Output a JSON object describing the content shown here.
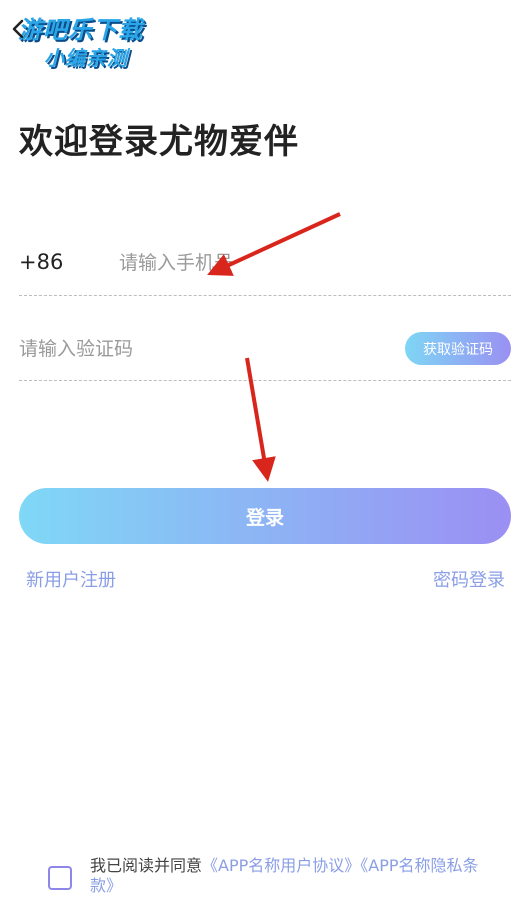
{
  "watermark": {
    "line1": "游吧乐下载",
    "line2": "小编亲测"
  },
  "header": {
    "back_icon": "chevron-left-icon"
  },
  "title": "欢迎登录尤物爱伴",
  "phone": {
    "country_code": "+86",
    "placeholder": "请输入手机号"
  },
  "code": {
    "placeholder": "请输入验证码",
    "get_code_label": "获取验证码"
  },
  "login_label": "登录",
  "links": {
    "register": "新用户注册",
    "password_login": "密码登录"
  },
  "agreement": {
    "prefix": "我已阅读并同意",
    "user_agreement": "《APP名称用户协议》",
    "privacy_policy": "《APP名称隐私条款》"
  },
  "colors": {
    "accent_start": "#7fd8f6",
    "accent_end": "#9b8ff3",
    "link": "#8a9ee6",
    "arrow": "#d9261c"
  }
}
